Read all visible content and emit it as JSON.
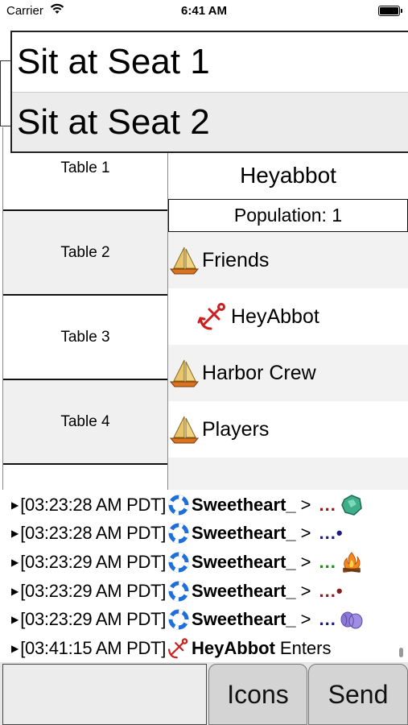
{
  "status_bar": {
    "carrier": "Carrier",
    "time": "6:41 AM"
  },
  "dropdown": {
    "items": [
      "Sit at Seat 1",
      "Sit at Seat 2"
    ]
  },
  "tables": [
    "Table 1",
    "Table 2",
    "Table 3",
    "Table 4"
  ],
  "room": {
    "name": "Heyabbot",
    "population": "Population: 1",
    "members": [
      {
        "label": "Friends",
        "icon": "sailboat-icon"
      },
      {
        "label": "HeyAbbot",
        "icon": "anchor-icon"
      },
      {
        "label": "Harbor Crew",
        "icon": "sailboat-icon"
      },
      {
        "label": "Players",
        "icon": "sailboat-icon"
      }
    ]
  },
  "chat": {
    "lines": [
      {
        "time": "[03:23:28 AM PDT]",
        "user": "Sweetheart_",
        "arrow": ">",
        "dots": "...",
        "emote": "green-gem-icon",
        "user_icon": "life-ring-icon"
      },
      {
        "time": "[03:23:28 AM PDT]",
        "user": "Sweetheart_",
        "arrow": ">",
        "dots": "...•",
        "emote": "",
        "user_icon": "life-ring-icon"
      },
      {
        "time": "[03:23:29 AM PDT]",
        "user": "Sweetheart_",
        "arrow": ">",
        "dots": "...",
        "emote": "campfire-icon",
        "user_icon": "life-ring-icon"
      },
      {
        "time": "[03:23:29 AM PDT]",
        "user": "Sweetheart_",
        "arrow": ">",
        "dots": "...•",
        "emote": "",
        "user_icon": "life-ring-icon"
      },
      {
        "time": "[03:23:29 AM PDT]",
        "user": "Sweetheart_",
        "arrow": ">",
        "dots": "...",
        "emote": "purple-yarn-icon",
        "user_icon": "life-ring-icon"
      },
      {
        "time": "[03:41:15 AM PDT]",
        "user": "HeyAbbot",
        "arrow": "",
        "dots": "Enters",
        "emote": "",
        "user_icon": "anchor-icon"
      }
    ]
  },
  "bottom": {
    "input_value": "",
    "icons_label": "Icons",
    "send_label": "Send"
  },
  "colors": {
    "anchor": "#cc1f1f",
    "life_ring": "#1e6fd9",
    "sail": "#e8c56a",
    "hull": "#d9731f"
  }
}
